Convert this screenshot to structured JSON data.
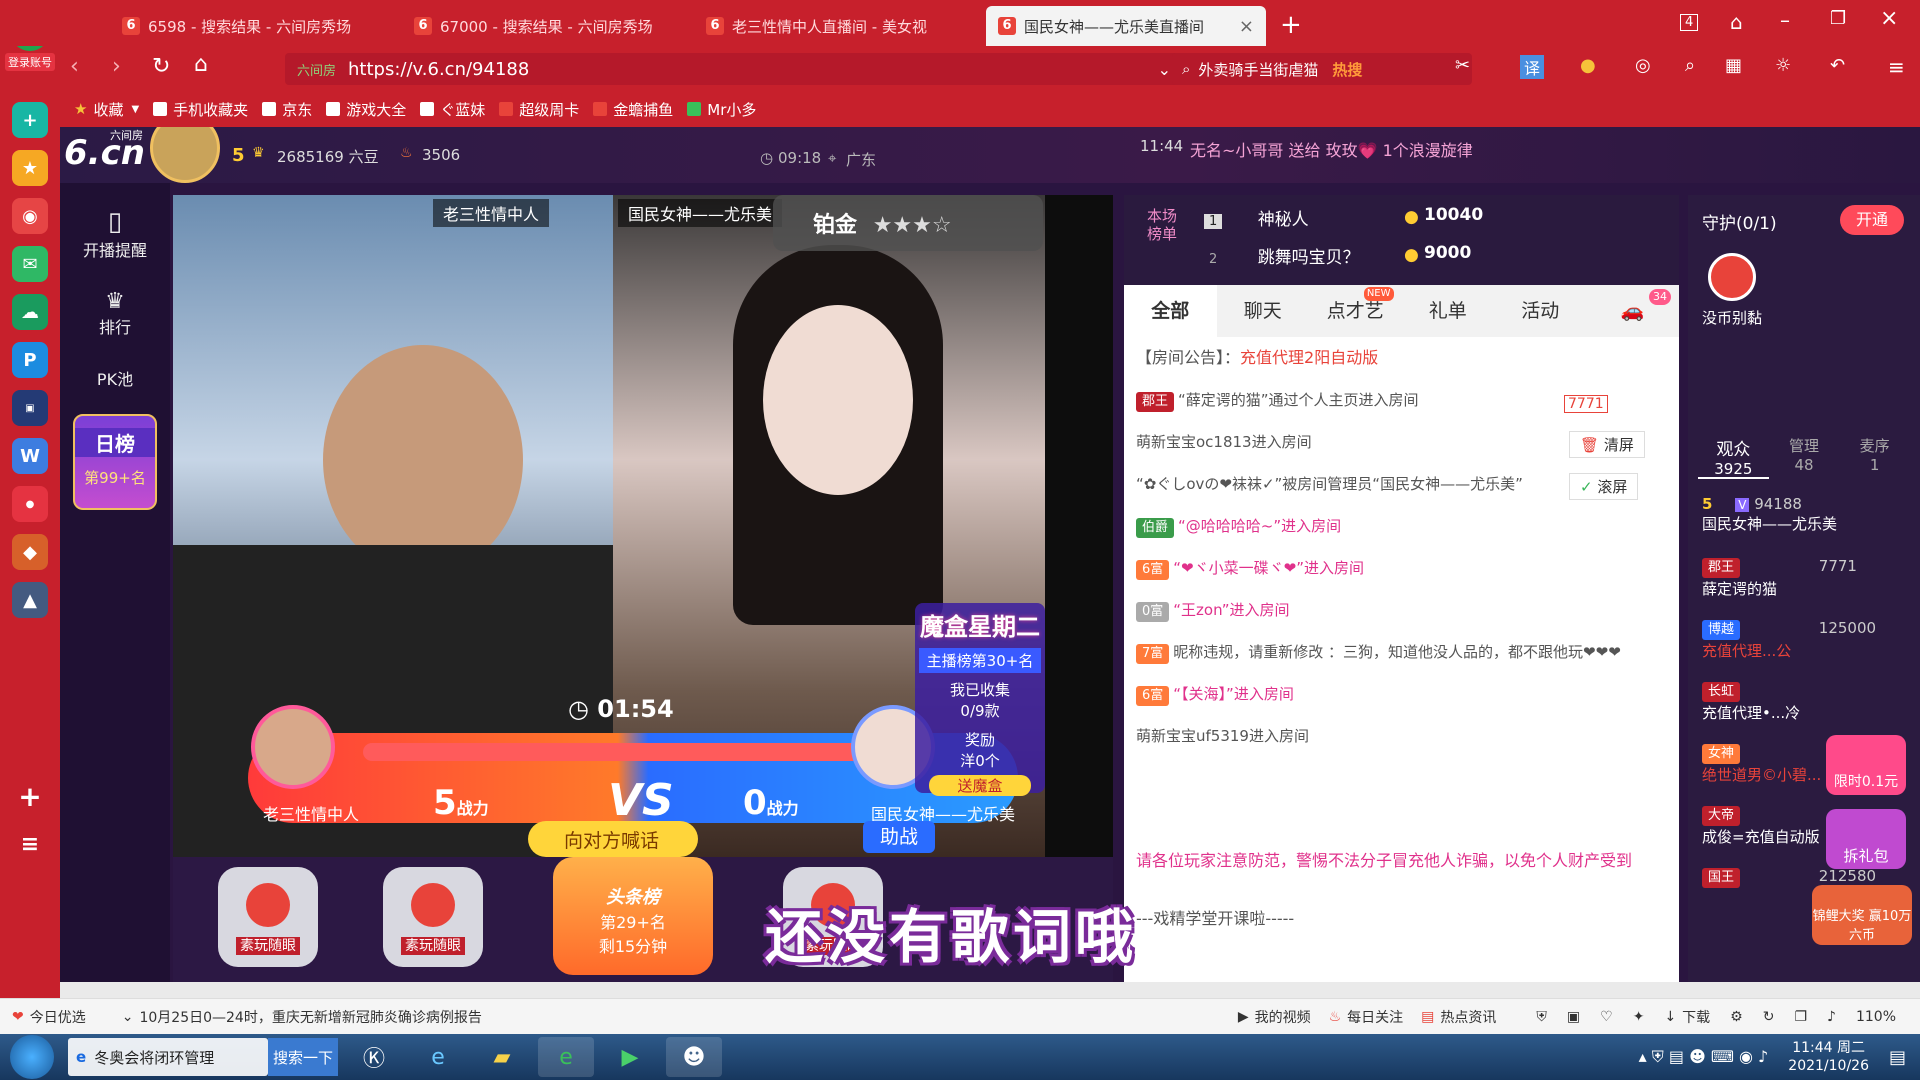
{
  "browser": {
    "login_label": "登录账号",
    "tabs": [
      {
        "label": "6598 - 搜索结果 - 六间房秀场"
      },
      {
        "label": "67000 - 搜索结果 - 六间房秀场"
      },
      {
        "label": "老三性情中人直播间 - 美女视"
      },
      {
        "label": "国民女神——尤乐美直播间"
      }
    ],
    "tab_count": "4",
    "url": "https://v.6.cn/94188",
    "url_prefix": "六间房",
    "search_text": "外卖骑手当街虐猫",
    "search_hot": "热搜",
    "bookmarks": [
      "收藏",
      "手机收藏夹",
      "京东",
      "游戏大全",
      "ぐ蓝妹",
      "超级周卡",
      "金蟾捕鱼",
      "Mr小多"
    ]
  },
  "site": {
    "logo": "6.cn",
    "logo_sub": "六间房",
    "anchor_level": "5",
    "anchor_beans": "2685169 六豆",
    "fans": "3506",
    "live_time": "09:18",
    "location": "广东",
    "marquee_time": "11:44",
    "marquee": "无名~小哥哥 送给 玫玫💗 1个浪漫旋律",
    "sidenav": [
      "开播提醒",
      "排行",
      "PK池",
      "日榜",
      "第99+名"
    ]
  },
  "video": {
    "left_name": "老三性情中人",
    "right_name": "国民女神——尤乐美",
    "rank_badge": "铂金",
    "timer": "01:54",
    "left_power": "5",
    "right_power": "0",
    "power_unit": "战力",
    "vs": "VS",
    "shout_btn": "向对方喊话",
    "help_btn": "助战",
    "event_title": "魔盒星期二",
    "event_rank": "主播榜第30+名",
    "event_collect": "我已收集",
    "event_count": "0/9款",
    "event_reward": "奖励",
    "event_ocean": "洋0个",
    "event_box": "送魔盒",
    "bottom_items": [
      "素玩随眼",
      "素玩随眼",
      "头条榜",
      "素玩随眼"
    ],
    "headline_rank": "第29+名",
    "headline_remain": "剩15分钟",
    "lyric": "还没有歌词哦"
  },
  "rank": {
    "label": "本场榜单",
    "rows": [
      {
        "n": "1",
        "name": "神秘人",
        "score": "10040"
      },
      {
        "n": "2",
        "name": "跳舞吗宝贝？",
        "score": "9000"
      }
    ]
  },
  "chat": {
    "tabs": [
      "全部",
      "聊天",
      "点才艺",
      "礼单",
      "活动"
    ],
    "new_tag": "NEW",
    "car_count": "34",
    "notice_label": "【房间公告】：",
    "notice": "充值代理2阳自动版",
    "car_num": "7771",
    "clear_btn": "清屏",
    "scroll_btn": "滚屏",
    "messages": [
      {
        "badge": "郡王",
        "text": "“薛定谔的猫”通过个人主页进入房间"
      },
      {
        "badge": "",
        "text": "萌新宝宝oc1813进入房间"
      },
      {
        "badge": "",
        "text": "“✿ぐしovの❤袜袜✓”被房间管理员“国民女神——尤乐美”"
      },
      {
        "badge": "伯爵",
        "text": "“@哈哈哈哈~”进入房间"
      },
      {
        "badge": "6富",
        "text": "“❤ヾ小菜一碟ヾ❤”进入房间"
      },
      {
        "badge": "0富",
        "text": "“王zon”进入房间"
      },
      {
        "badge": "7富",
        "text": "昵称违规，请重新修改 ：三狗，知道他没人品的，都不跟他玩❤❤❤"
      },
      {
        "badge": "6富",
        "text": "“【关海】”进入房间"
      },
      {
        "badge": "",
        "text": "萌新宝宝uf5319进入房间"
      }
    ],
    "warning": "请各位玩家注意防范，警惕不法分子冒充他人诈骗，以免个人财产受到",
    "course": "---戏精学堂开课啦-----"
  },
  "guard": {
    "title": "守护(0/1)",
    "open_btn": "开通",
    "no_coin": "没币别黏",
    "tabs": [
      {
        "label": "观众",
        "count": "3925"
      },
      {
        "label": "管理",
        "count": "48"
      },
      {
        "label": "麦序",
        "count": "1"
      }
    ],
    "users": [
      {
        "level": "5",
        "id": "94188",
        "name": "国民女神——尤乐美"
      },
      {
        "badge": "郡王",
        "id": "7771",
        "name": "薛定谔的猫"
      },
      {
        "badge": "博越",
        "id": "125000",
        "name": "充值代理...公"
      },
      {
        "badge": "长虹",
        "id": "",
        "name": "充值代理•...冷"
      },
      {
        "badge": "女神",
        "id": "",
        "name": "绝世道男©小碧..."
      },
      {
        "badge": "大帝",
        "id": "",
        "name": "成俊=充值自动版"
      },
      {
        "badge": "国王",
        "id": "212580",
        "name": ""
      }
    ],
    "promo1": "限时0.1元",
    "promo2": "拆礼包",
    "promo3": "锦鲤大奖 赢10万六币"
  },
  "statusbar": {
    "today": "今日优选",
    "news": "10月25日0—24时，重庆无新增新冠肺炎确诊病例报告",
    "my_video": "我的视频",
    "daily": "每日关注",
    "hot": "热点资讯",
    "download": "下载",
    "zoom": "110%"
  },
  "taskbar": {
    "active_app": "冬奥会将闭环管理",
    "search_btn": "搜索一下",
    "time": "11:44 周二",
    "date": "2021/10/26"
  }
}
